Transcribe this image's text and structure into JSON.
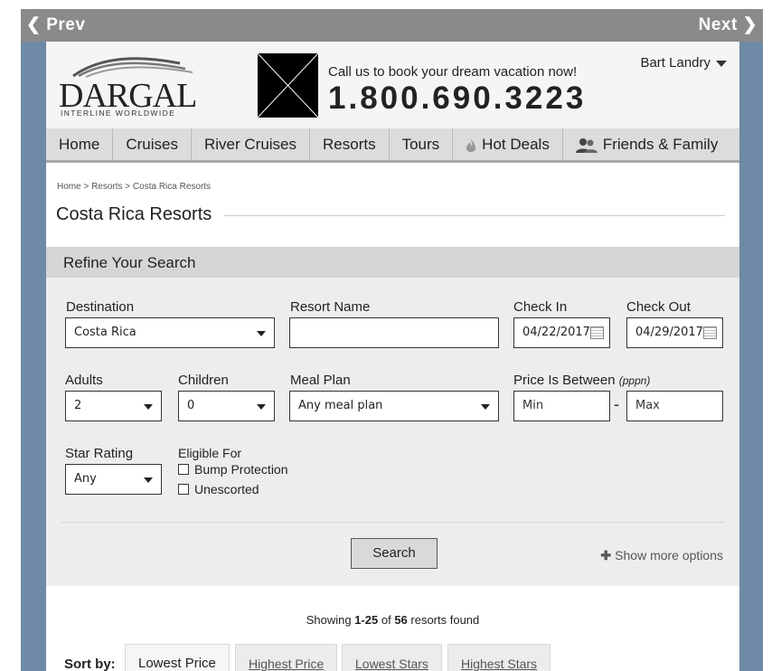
{
  "pager": {
    "prev_label": "Prev",
    "next_label": "Next"
  },
  "header": {
    "logo_name": "DARGAL",
    "logo_tagline": "INTERLINE WORLDWIDE",
    "call_text": "Call us to book your dream vacation now!",
    "phone": "1.800.690.3223",
    "user_name": "Bart Landry"
  },
  "nav": {
    "items": [
      {
        "label": "Home"
      },
      {
        "label": "Cruises"
      },
      {
        "label": "River Cruises"
      },
      {
        "label": "Resorts"
      },
      {
        "label": "Tours"
      },
      {
        "label": "Hot Deals",
        "icon": "flame-icon"
      },
      {
        "label": "Friends & Family",
        "icon": "people-icon"
      }
    ]
  },
  "breadcrumb": "Home > Resorts > Costa Rica Resorts",
  "page_title": "Costa Rica Resorts",
  "refine": {
    "heading": "Refine Your Search",
    "destination": {
      "label": "Destination",
      "value": "Costa Rica"
    },
    "resort_name": {
      "label": "Resort Name",
      "value": ""
    },
    "check_in": {
      "label": "Check In",
      "value": "04/22/2017"
    },
    "check_out": {
      "label": "Check Out",
      "value": "04/29/2017"
    },
    "adults": {
      "label": "Adults",
      "value": "2"
    },
    "children": {
      "label": "Children",
      "value": "0"
    },
    "meal_plan": {
      "label": "Meal Plan",
      "value": "Any meal plan"
    },
    "price": {
      "label": "Price Is Between",
      "label_suffix": "(pppn)",
      "min_placeholder": "Min",
      "max_placeholder": "Max",
      "separator": "-"
    },
    "star_rating": {
      "label": "Star Rating",
      "value": "Any"
    },
    "eligible": {
      "label": "Eligible For",
      "options": [
        "Bump Protection",
        "Unescorted"
      ]
    },
    "search_label": "Search",
    "more_label": "Show more options"
  },
  "results": {
    "showing_prefix": "Showing ",
    "range": "1-25",
    "of_text": " of ",
    "total": "56",
    "suffix": " resorts found"
  },
  "sort": {
    "label": "Sort by:",
    "options": [
      "Lowest Price",
      "Highest Price",
      "Lowest Stars",
      "Highest Stars"
    ]
  },
  "colors": {
    "frame": "#6f8aa6",
    "pager": "#8a8a8a"
  }
}
